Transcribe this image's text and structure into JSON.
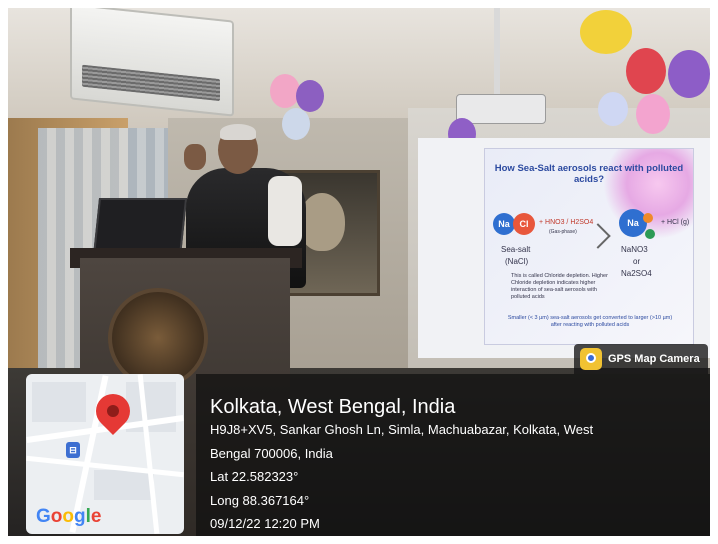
{
  "slide": {
    "title": "How Sea-Salt aerosols react with polluted acids?",
    "na": "Na",
    "cl": "Cl",
    "reagent": "+ HNO3 / H2SO4",
    "phase": "(Gas-phase)",
    "product_hcl": "+ HCl (g)",
    "sea_salt": "Sea-salt",
    "nacl": "(NaCl)",
    "products": [
      "NaNO3",
      "or",
      "Na2SO4"
    ],
    "explanation": "This is called Chloride depletion. Higher Chloride depletion indicates higher interaction of sea-salt aerosols with polluted acids",
    "footnote": "Smaller (< 3 µm) sea-salt aerosols get converted to larger (>10 µm) after reacting with polluted acids"
  },
  "overlay": {
    "app_name": "GPS Map Camera",
    "location_title": "Kolkata, West Bengal, India",
    "address_line1": "H9J8+XV5, Sankar Ghosh Ln, Simla, Machuabazar, Kolkata, West",
    "address_line2": "Bengal 700006, India",
    "latitude": "Lat 22.582323°",
    "longitude": "Long 88.367164°",
    "datetime": "09/12/22 12:20 PM",
    "map_logo": [
      "G",
      "o",
      "o",
      "g",
      "l",
      "e"
    ],
    "map_logo_colors": [
      "#4285F4",
      "#EA4335",
      "#FBBC05",
      "#4285F4",
      "#34A853",
      "#EA4335"
    ],
    "transit_icon": "train-station-icon",
    "pin_icon": "map-pin-icon",
    "badge_icon": "camera-icon"
  }
}
